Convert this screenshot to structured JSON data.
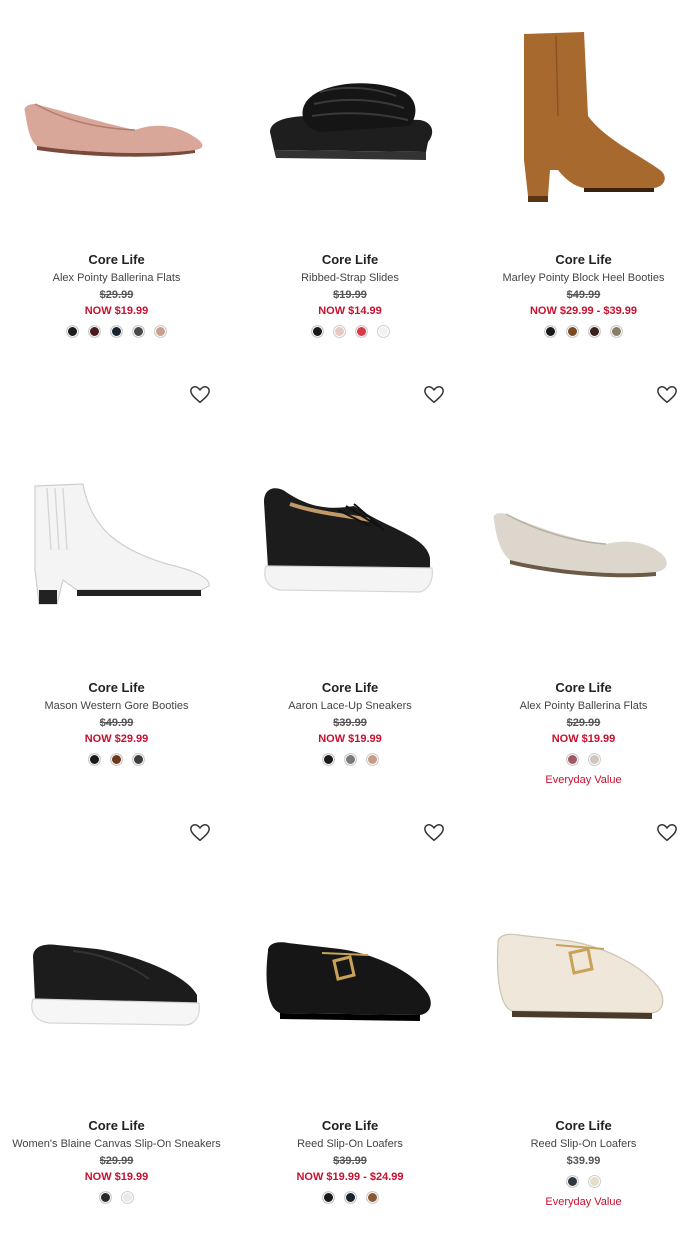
{
  "colors": {
    "sale": "#c8102e"
  },
  "products": [
    {
      "brand": "Core Life",
      "name": "Alex Pointy Ballerina Flats",
      "orig_price": "$29.99",
      "sale_price": "NOW $19.99",
      "tag": "",
      "image": "pink-pointy-flat",
      "favorite": false,
      "swatches": [
        "#1c1c1c",
        "#4a1a1e",
        "#1a2330",
        "#4a4a4a",
        "#c9a08e"
      ]
    },
    {
      "brand": "Core Life",
      "name": "Ribbed-Strap Slides",
      "orig_price": "$19.99",
      "sale_price": "NOW $14.99",
      "tag": "",
      "image": "black-slide",
      "favorite": false,
      "swatches": [
        "#1a1a1a",
        "#e8c8c4",
        "#d93a48",
        "#f2f2f2"
      ]
    },
    {
      "brand": "Core Life",
      "name": "Marley Pointy Block Heel Booties",
      "orig_price": "$49.99",
      "sale_price": "NOW $29.99 - $39.99",
      "tag": "",
      "image": "tan-bootie",
      "favorite": false,
      "swatches": [
        "#1a1a1a",
        "#7a4a22",
        "#3b1f1a",
        "#8a7d66"
      ]
    },
    {
      "brand": "Core Life",
      "name": "Mason Western Gore Booties",
      "orig_price": "$49.99",
      "sale_price": "NOW $29.99",
      "tag": "",
      "image": "white-bootie",
      "favorite": true,
      "swatches": [
        "#1a1a1a",
        "#6b3a1a",
        "#3d3d3d"
      ]
    },
    {
      "brand": "Core Life",
      "name": "Aaron Lace-Up Sneakers",
      "orig_price": "$39.99",
      "sale_price": "NOW $19.99",
      "tag": "",
      "image": "black-sneaker",
      "favorite": true,
      "swatches": [
        "#1a1a1a",
        "#7a7a7a",
        "#c9998a"
      ]
    },
    {
      "brand": "Core Life",
      "name": "Alex Pointy Ballerina Flats",
      "orig_price": "$29.99",
      "sale_price": "NOW $19.99",
      "tag": "Everyday Value",
      "image": "stone-flat",
      "favorite": true,
      "swatches": [
        "#a05a66",
        "#cfc6bd"
      ]
    },
    {
      "brand": "Core Life",
      "name": "Women's Blaine Canvas Slip-On Sneakers",
      "orig_price": "$29.99",
      "sale_price": "NOW $19.99",
      "tag": "",
      "image": "black-slip-on",
      "favorite": true,
      "swatches": [
        "#2a2a2a",
        "#eaeaea"
      ]
    },
    {
      "brand": "Core Life",
      "name": "Reed Slip-On Loafers",
      "orig_price": "$39.99",
      "sale_price": "NOW $19.99 - $24.99",
      "tag": "",
      "image": "black-loafer",
      "favorite": true,
      "swatches": [
        "#1a1a1a",
        "#1a2330",
        "#8a5a36"
      ]
    },
    {
      "brand": "Core Life",
      "name": "Reed Slip-On Loafers",
      "orig_price": "$39.99",
      "sale_price": "",
      "tag": "Everyday Value",
      "image": "cream-loafer",
      "favorite": true,
      "swatches": [
        "#2f3640",
        "#e6dcc8"
      ]
    }
  ]
}
